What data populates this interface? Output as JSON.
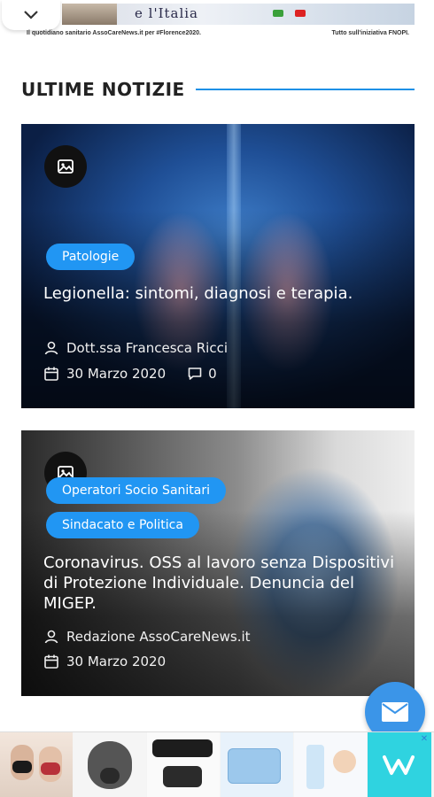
{
  "banner": {
    "tagline": "e l'Italia",
    "caption_left": "Il quotidiano sanitario AssoCareNews.it per #Florence2020.",
    "caption_right": "Tutto sull'iniziativa FNOPI."
  },
  "section": {
    "title": "ULTIME NOTIZIE",
    "accent_color": "#1e90e6"
  },
  "articles": [
    {
      "categories": [
        "Patologie"
      ],
      "title": "Legionella: sintomi, diagnosi e terapia.",
      "author": "Dott.ssa Francesca Ricci",
      "date": "30 Marzo 2020",
      "comments": "0",
      "media_icon": "image-icon"
    },
    {
      "categories": [
        "Operatori Socio Sanitari",
        "Sindacato e Politica"
      ],
      "title": "Coronavirus. OSS al lavoro senza Dispositivi di Protezione Individuale. Denuncia del MIGEP.",
      "author": "Redazione AssoCareNews.it",
      "date": "30 Marzo 2020",
      "media_icon": "image-icon"
    }
  ],
  "colors": {
    "pill": "#2196f3",
    "fab": "#3b95e8",
    "ad_brand": "#2fd3e0"
  },
  "icons": {
    "collapse": "chevron-down-icon",
    "author": "user-icon",
    "date": "calendar-icon",
    "comments": "comment-icon",
    "fab": "mail-icon",
    "ad_close": "close-icon"
  }
}
